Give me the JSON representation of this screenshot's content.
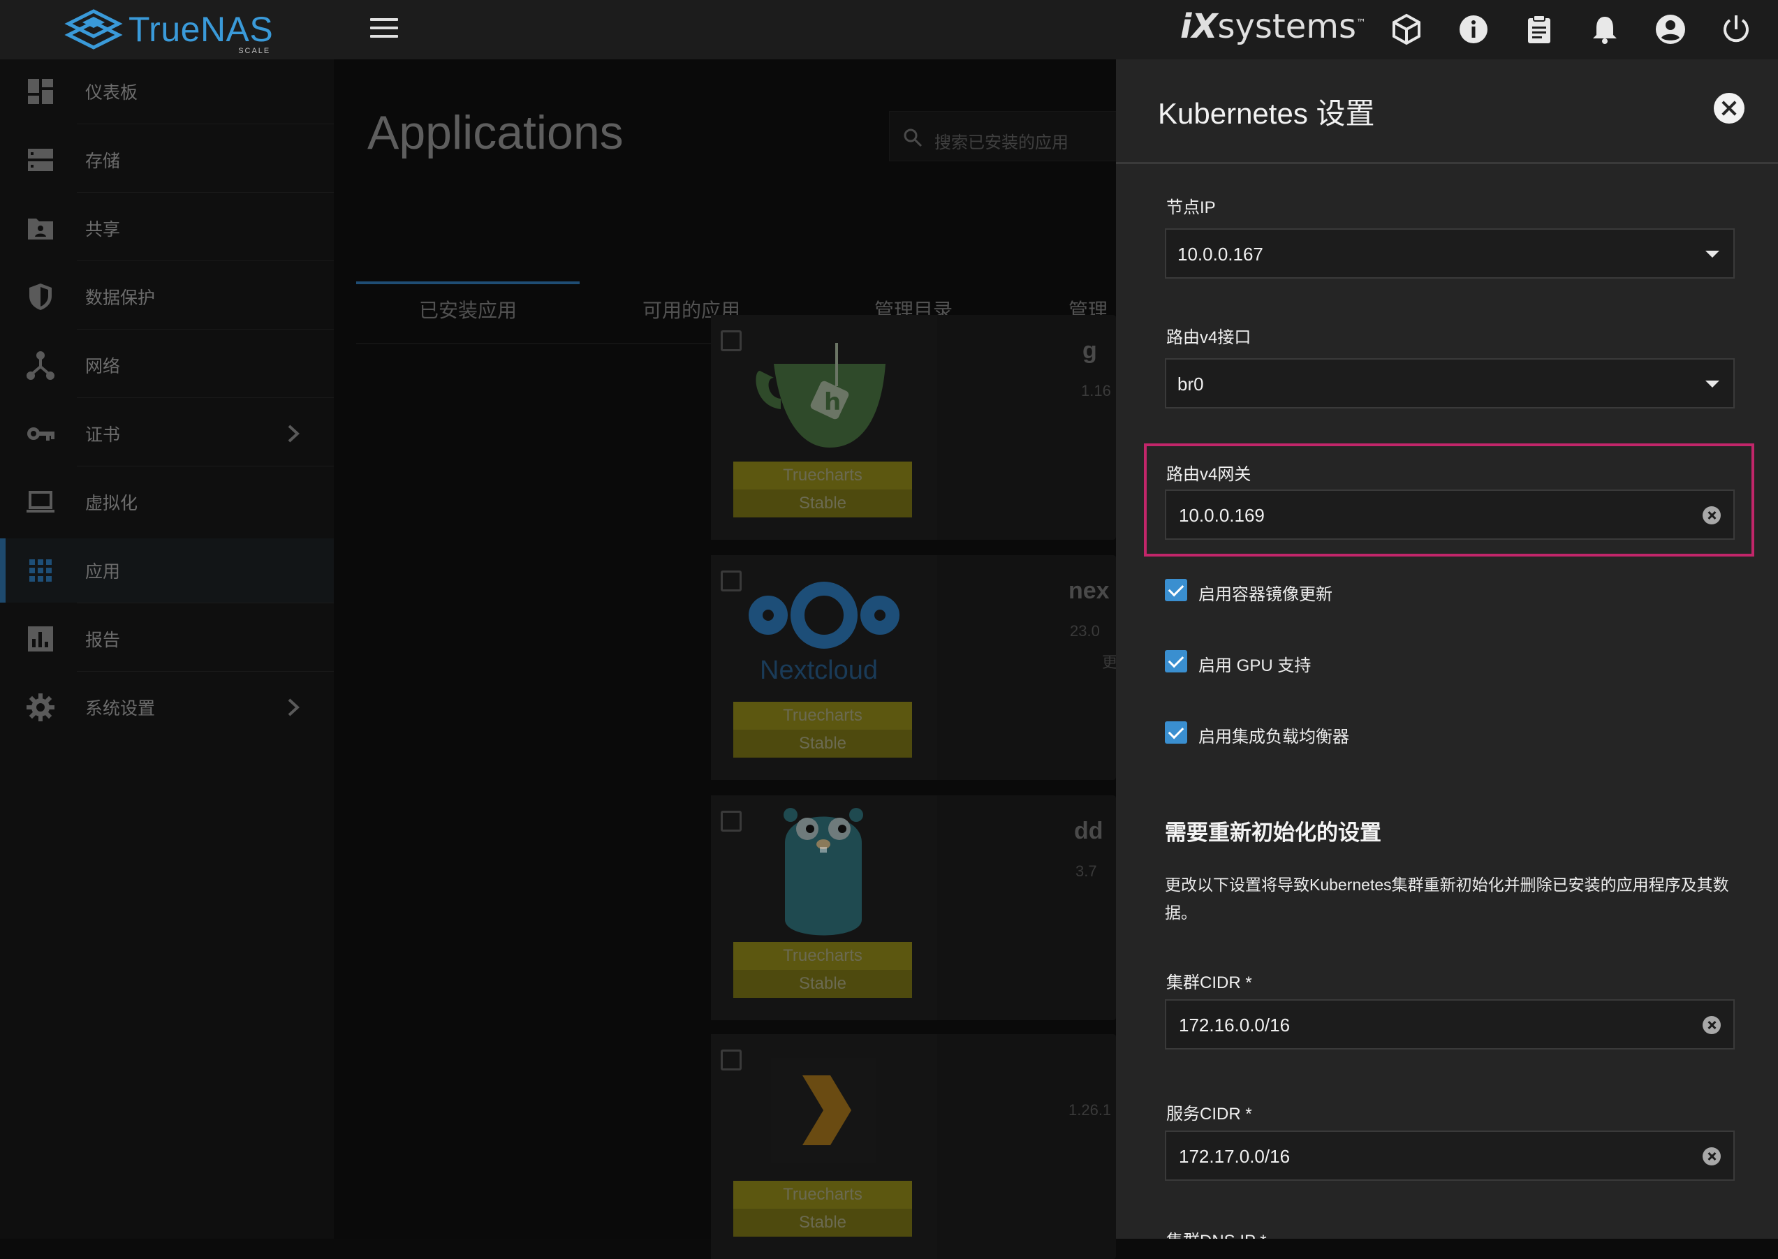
{
  "header": {
    "logo_text": "TrueNAS",
    "logo_sub": "SCALE",
    "vendor_logo_i": "iX",
    "vendor_logo_text": "systems",
    "vendor_logo_tm": "™"
  },
  "sidebar": {
    "items": [
      {
        "label": "仪表板",
        "icon": "dashboard-icon"
      },
      {
        "label": "存储",
        "icon": "storage-icon"
      },
      {
        "label": "共享",
        "icon": "folder-share-icon"
      },
      {
        "label": "数据保护",
        "icon": "shield-icon"
      },
      {
        "label": "网络",
        "icon": "network-icon"
      },
      {
        "label": "证书",
        "icon": "key-icon"
      },
      {
        "label": "虚拟化",
        "icon": "laptop-icon"
      },
      {
        "label": "应用",
        "icon": "apps-grid-icon"
      },
      {
        "label": "报告",
        "icon": "chart-icon"
      },
      {
        "label": "系统设置",
        "icon": "gear-icon"
      }
    ]
  },
  "main": {
    "title": "Applications",
    "search_placeholder": "搜索已安装的应用",
    "tabs": [
      {
        "label": "已安装应用"
      },
      {
        "label": "可用的应用"
      },
      {
        "label": "管理目录"
      },
      {
        "label": "管理D"
      }
    ],
    "cards": [
      {
        "badge1": "Truecharts",
        "badge2": "Stable",
        "name": "g",
        "version": "1.16"
      },
      {
        "badge1": "Truecharts",
        "badge2": "Stable",
        "name": "nex",
        "version": "23.0",
        "extra": "更",
        "logo_text": "Nextcloud"
      },
      {
        "badge1": "Truecharts",
        "badge2": "Stable",
        "name": "dd",
        "version": "3.7"
      },
      {
        "badge1": "Truecharts",
        "badge2": "Stable",
        "name": "",
        "version": "1.26.1"
      }
    ]
  },
  "panel": {
    "title": "Kubernetes 设置",
    "node_ip": {
      "label": "节点IP",
      "value": "10.0.0.167"
    },
    "route_iface": {
      "label": "路由v4接口",
      "value": "br0"
    },
    "route_gw": {
      "label": "路由v4网关",
      "value": "10.0.0.169"
    },
    "checkboxes": [
      {
        "label": "启用容器镜像更新",
        "checked": true
      },
      {
        "label": "启用 GPU 支持",
        "checked": true
      },
      {
        "label": "启用集成负载均衡器",
        "checked": true
      }
    ],
    "section_title": "需要重新初始化的设置",
    "section_desc": "更改以下设置将导致Kubernetes集群重新初始化并删除已安装的应用程序及其数据。",
    "cluster_cidr": {
      "label": "集群CIDR *",
      "value": "172.16.0.0/16"
    },
    "service_cidr": {
      "label": "服务CIDR *",
      "value": "172.17.0.0/16"
    },
    "cluster_dns": {
      "label": "集群DNS IP *"
    }
  },
  "colors": {
    "accent": "#3a8fd0",
    "highlight": "#c2266a",
    "badge": "#5c5710",
    "panel_bg": "#252525"
  }
}
